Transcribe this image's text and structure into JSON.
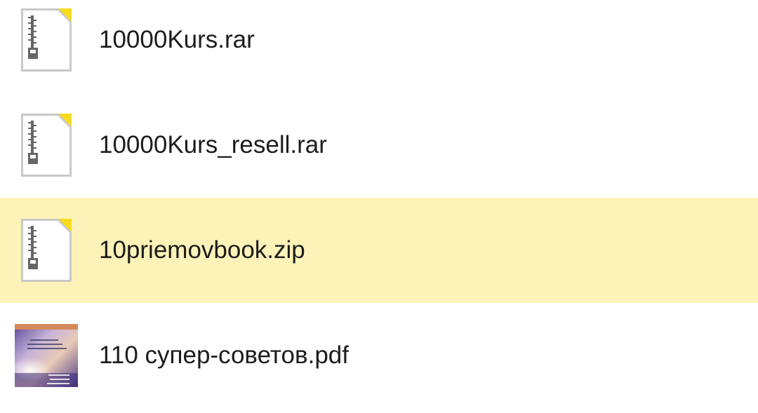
{
  "files": [
    {
      "name": "10000Kurs.rar",
      "icon": "archive-icon",
      "selected": false
    },
    {
      "name": "10000Kurs_resell.rar",
      "icon": "archive-icon",
      "selected": false
    },
    {
      "name": "10priemovbook.zip",
      "icon": "archive-icon",
      "selected": true
    },
    {
      "name": "110 супер-советов.pdf",
      "icon": "pdf-thumbnail",
      "selected": false
    }
  ],
  "colors": {
    "selected_row": "#fdf3b9",
    "icon_corner": "#f7dc1c",
    "icon_border": "#c8c8c8",
    "zipper": "#666666",
    "text": "#1c1c1c"
  }
}
